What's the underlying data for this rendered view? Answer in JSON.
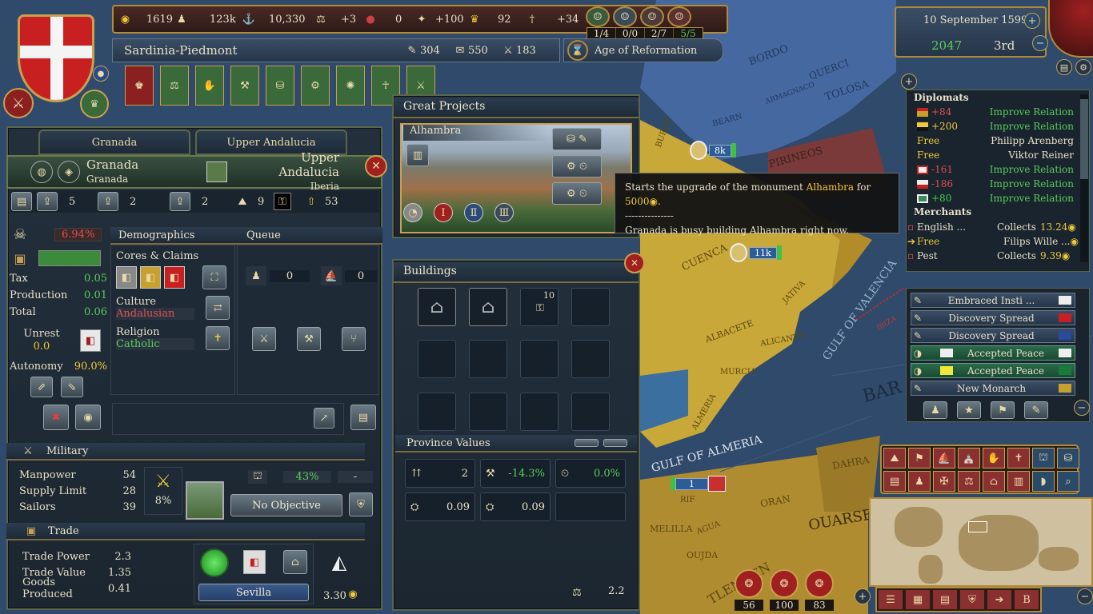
{
  "topbar": {
    "treasury": "1619",
    "manpower": "123k",
    "sailors": "10,330",
    "stability": "+3",
    "corruption": "0",
    "prestige": "+100",
    "legitimacy": "92",
    "power_projection": "+34",
    "envoys": [
      "1/4",
      "0/0",
      "2/7",
      "5/5"
    ],
    "country_name": "Sardinia-Piedmont",
    "adm": "304",
    "dip": "550",
    "mil": "183",
    "age": "Age of Reformation",
    "date": "10 September 1599",
    "score": "2047",
    "rank": "3rd"
  },
  "province_tabs": [
    "Granada",
    "Upper Andalucia"
  ],
  "province": {
    "name": "Granada",
    "capital": "Granada",
    "area": "Upper Andalucia",
    "region": "Iberia",
    "dev_tax": "5",
    "dev_prod": "2",
    "dev_man": "2",
    "dev_total": "9",
    "dev_cost": "53",
    "devastation": "6.94%",
    "tax_label": "Tax",
    "tax": "0.05",
    "prod_label": "Production",
    "prod": "0.01",
    "total_label": "Total",
    "total": "0.06",
    "unrest_label": "Unrest",
    "unrest": "0.0",
    "autonomy_label": "Autonomy",
    "autonomy": "90.0%",
    "demographics_label": "Demographics",
    "queue_label": "Queue",
    "cores_label": "Cores & Claims",
    "culture_label": "Culture",
    "culture": "Andalusian",
    "religion_label": "Religion",
    "religion": "Catholic",
    "queue_a": "0",
    "queue_b": "0"
  },
  "military": {
    "title": "Military",
    "manpower_label": "Manpower",
    "manpower": "54",
    "supply_label": "Supply Limit",
    "supply": "28",
    "sailors_label": "Sailors",
    "sailors": "39",
    "fort_pct": "8%",
    "siege_pct": "43%",
    "siege_dash": "-",
    "objective": "No Objective"
  },
  "trade": {
    "title": "Trade",
    "power_label": "Trade Power",
    "power": "2.3",
    "value_label": "Trade Value",
    "value": "1.35",
    "goods_label": "Goods Produced",
    "goods": "0.41",
    "node": "Sevilla",
    "goods_price": "3.30"
  },
  "great_projects": {
    "title": "Great Projects",
    "project": "Alhambra"
  },
  "tooltip": {
    "line1_pre": "Starts the upgrade of the monument ",
    "line1_name": "Alhambra",
    "line1_mid": " for ",
    "line1_cost": "5000",
    "line1_post": ".",
    "separator": "---------------",
    "line2": "Granada is busy building Alhambra right now."
  },
  "buildings": {
    "title": "Buildings",
    "slot_count": "10"
  },
  "province_values": {
    "title": "Province Values",
    "v1": "2",
    "v2": "-14.3%",
    "v3": "0.0%",
    "v4": "0.09",
    "v5": "0.09",
    "bottom": "2.2"
  },
  "diplomats": {
    "title": "Diplomats",
    "rows": [
      {
        "value": "+84",
        "action": "Improve Relation"
      },
      {
        "value": "+200",
        "action": "Improve Relation"
      },
      {
        "value": "Free",
        "action": "Philipp Arenberg"
      },
      {
        "value": "Free",
        "action": "Viktor Reiner"
      },
      {
        "value": "-161",
        "action": "Improve Relation"
      },
      {
        "value": "-186",
        "action": "Improve Relation"
      },
      {
        "value": "+80",
        "action": "Improve Relation"
      }
    ]
  },
  "merchants": {
    "title": "Merchants",
    "rows": [
      {
        "name": "English ...",
        "action": "Collects",
        "value": "13.24"
      },
      {
        "name": "Free",
        "action": "Filips Wille ...",
        "value": ""
      },
      {
        "name": "Pest",
        "action": "Collects",
        "value": "9.39"
      }
    ]
  },
  "notifications": [
    "Embraced Insti ...",
    "Discovery Spread",
    "Discovery Spread",
    "Accepted Peace",
    "Accepted Peace",
    "New Monarch"
  ],
  "map": {
    "labels": [
      "BORDO",
      "QUERCI",
      "TOLOSA",
      "ARMAGNACO",
      "PIRINEOS",
      "BEARN",
      "CUENCA",
      "ALBACETE",
      "ALICANTE",
      "JATIVA",
      "MURCIA",
      "ALMERIA",
      "GULF OF VALENCIA",
      "IBIZA",
      "BAR",
      "GULF OF ALMERIA",
      "ORAN",
      "OUARSE",
      "TLEMCEN",
      "OUJDA",
      "MELILLA",
      "AGUA",
      "DAHRA",
      "RIF",
      "BURGO"
    ],
    "army1": "8k",
    "army2": "11k",
    "army3": "1"
  },
  "bottom_right": {
    "counts": [
      "56",
      "100",
      "83"
    ]
  },
  "colors": {
    "gold": "#b18a3a",
    "panel": "#1b2630",
    "positive": "#43d143",
    "negative": "#e05050"
  }
}
